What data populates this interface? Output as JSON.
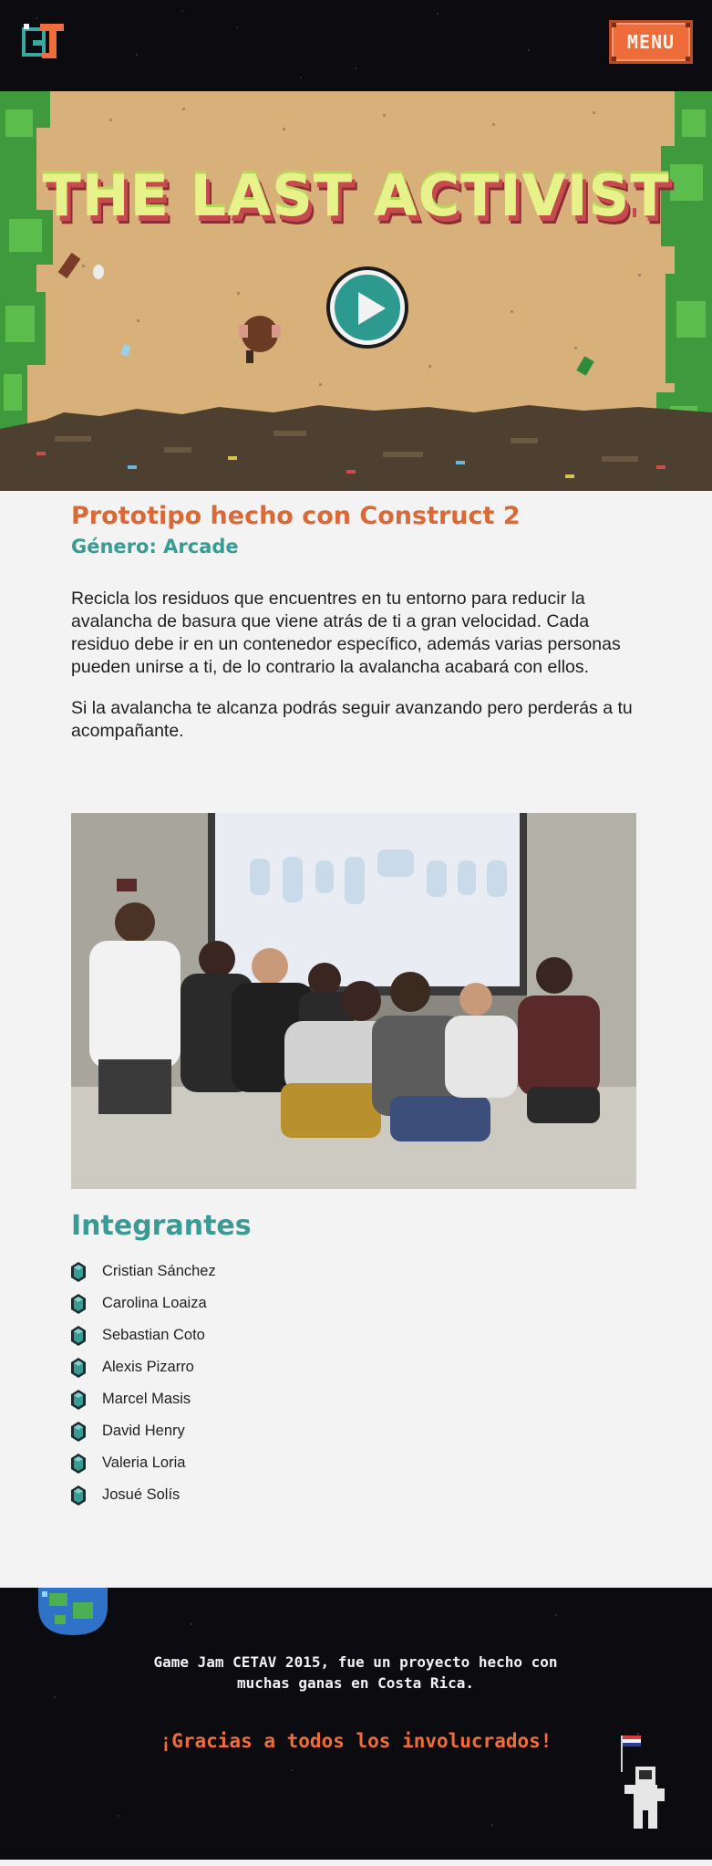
{
  "header": {
    "logo_icon": "gj-logo-icon",
    "menu_label": "MENU",
    "accent": "#ee6b3a"
  },
  "hero": {
    "title": "THE LAST ACTIVIST",
    "play_icon": "play-icon",
    "title_color": "#e7f28a",
    "ground_color": "#d8b07a"
  },
  "project": {
    "title": "Prototipo hecho con Construct 2",
    "genre": "Género: Arcade",
    "paragraphs": [
      "Recicla los residuos que encuentres en tu entorno para reducir la avalancha de basura que viene atrás de ti a gran velocidad. Cada residuo debe ir en un contenedor específico, además varias personas pueden unirse a ti, de lo contrario la avalancha acabará con ellos.",
      "Si la avalancha te alcanza podrás seguir avanzando pero perderás a tu acompañante."
    ]
  },
  "team": {
    "title": "Integrantes",
    "bullet_icon": "gem-icon",
    "members": [
      "Cristian Sánchez",
      "Carolina Loaiza",
      "Sebastian Coto",
      "Alexis Pizarro",
      "Marcel Masis",
      "David Henry",
      "Valeria Loria",
      "Josué Solís"
    ]
  },
  "footer": {
    "line1": "Game Jam CETAV 2015, fue un proyecto hecho con",
    "line2": "muchas ganas en Costa Rica.",
    "thanks": "¡Gracias a todos los involucrados!",
    "planet_icon": "earth-icon",
    "astronaut_icon": "astronaut-icon"
  },
  "colors": {
    "title_orange": "#d96a37",
    "teal": "#3a9b94",
    "dark_bg": "#0b0b10"
  }
}
